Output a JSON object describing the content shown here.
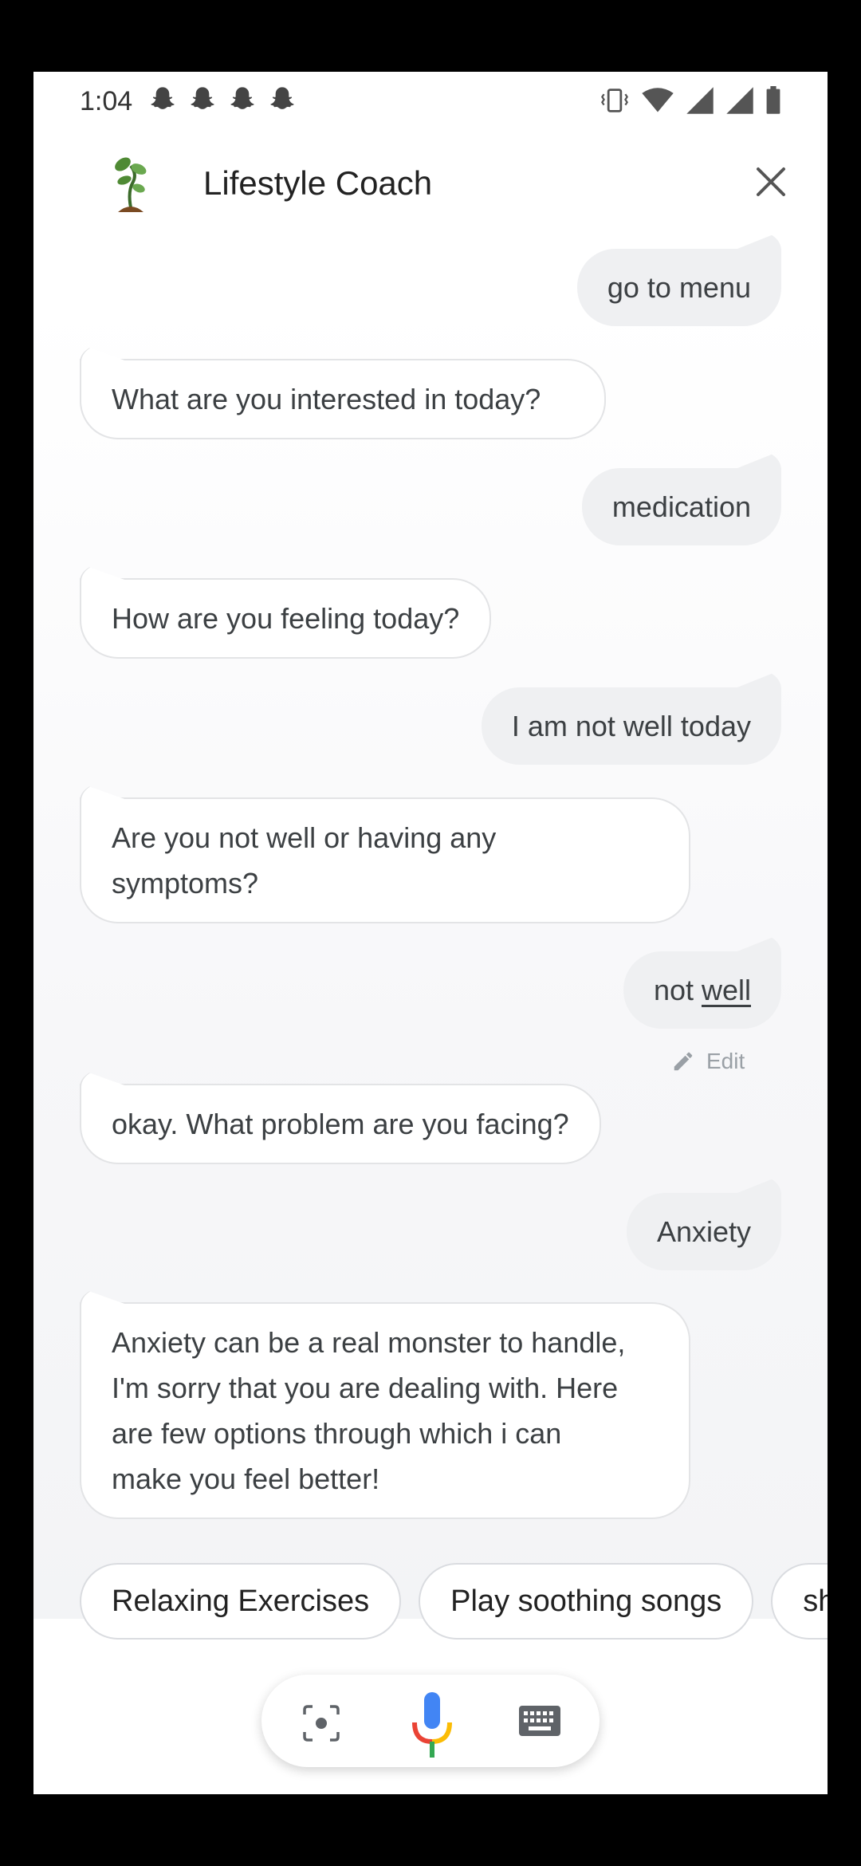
{
  "status_bar": {
    "time": "1:04",
    "notification_icons": [
      "snapchat-icon",
      "snapchat-icon",
      "snapchat-icon",
      "snapchat-icon"
    ],
    "system_icons": [
      "vibrate-icon",
      "wifi-icon",
      "signal-icon",
      "signal-icon",
      "battery-icon"
    ]
  },
  "header": {
    "title": "Lifestyle Coach",
    "logo_icon": "sprout-plant-icon",
    "close_icon": "close-icon"
  },
  "messages": [
    {
      "sender": "user",
      "text": "go to menu"
    },
    {
      "sender": "bot",
      "text": "What are  you interested in today?"
    },
    {
      "sender": "user",
      "text": "medication"
    },
    {
      "sender": "bot",
      "text": "How are you feeling today?"
    },
    {
      "sender": "user",
      "text": "I am not well today"
    },
    {
      "sender": "bot",
      "text": "Are you not well or having any\nsymptoms?"
    },
    {
      "sender": "user",
      "text_before": "not ",
      "text_underlined": "well"
    },
    {
      "sender": "bot",
      "text": "okay. What problem are you facing?"
    },
    {
      "sender": "user",
      "text": "Anxiety"
    },
    {
      "sender": "bot",
      "text": "Anxiety can be a real monster to handle,\nI'm sorry that you are dealing with. Here\nare few options through which i can\nmake you feel better!"
    }
  ],
  "edit": {
    "label": "Edit",
    "icon": "pencil-icon"
  },
  "suggestions": [
    "Relaxing Exercises",
    "Play soothing songs",
    "sh"
  ],
  "input_bar": {
    "icons": [
      "lens-icon",
      "microphone-icon",
      "keyboard-icon"
    ]
  },
  "colors": {
    "user_bubble": "#eff0f2",
    "bot_bubble_border": "#e3e4e6",
    "mic_blue": "#4285f4",
    "mic_red": "#ea4335",
    "mic_yellow": "#fbbc05",
    "mic_green": "#34a853"
  }
}
